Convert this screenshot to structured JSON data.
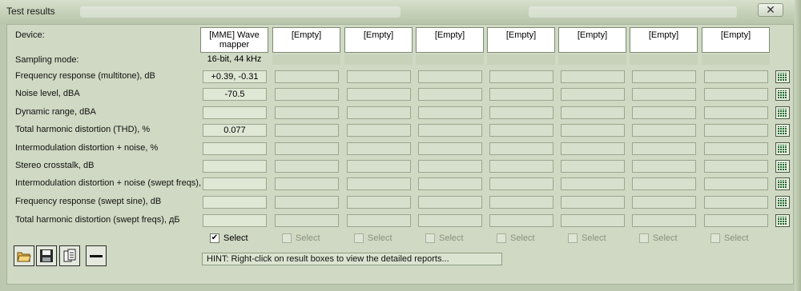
{
  "window": {
    "title": "Test results",
    "close_glyph": "✕"
  },
  "labels": {
    "device": "Device:",
    "sampling_mode": "Sampling mode:"
  },
  "devices": [
    "[MME] Wave mapper",
    "[Empty]",
    "[Empty]",
    "[Empty]",
    "[Empty]",
    "[Empty]",
    "[Empty]",
    "[Empty]"
  ],
  "sampling_modes": [
    "16-bit, 44 kHz",
    "",
    "",
    "",
    "",
    "",
    "",
    ""
  ],
  "rows": [
    {
      "label": "Frequency response (multitone), dB",
      "values": [
        "+0.39, -0.31",
        "",
        "",
        "",
        "",
        "",
        "",
        ""
      ]
    },
    {
      "label": "Noise level, dBA",
      "values": [
        "-70.5",
        "",
        "",
        "",
        "",
        "",
        "",
        ""
      ]
    },
    {
      "label": "Dynamic range, dBA",
      "values": [
        "",
        "",
        "",
        "",
        "",
        "",
        "",
        ""
      ]
    },
    {
      "label": "Total harmonic distortion (THD), %",
      "values": [
        "0.077",
        "",
        "",
        "",
        "",
        "",
        "",
        ""
      ]
    },
    {
      "label": "Intermodulation distortion + noise, %",
      "values": [
        "",
        "",
        "",
        "",
        "",
        "",
        "",
        ""
      ]
    },
    {
      "label": "Stereo crosstalk, dB",
      "values": [
        "",
        "",
        "",
        "",
        "",
        "",
        "",
        ""
      ]
    },
    {
      "label": "Intermodulation distortion + noise (swept freqs), %",
      "values": [
        "",
        "",
        "",
        "",
        "",
        "",
        "",
        ""
      ]
    },
    {
      "label": "Frequency response (swept sine), dB",
      "values": [
        "",
        "",
        "",
        "",
        "",
        "",
        "",
        ""
      ]
    },
    {
      "label": "Total harmonic distortion (swept freqs), дБ",
      "values": [
        "",
        "",
        "",
        "",
        "",
        "",
        "",
        ""
      ]
    }
  ],
  "selects": [
    {
      "label": "Select",
      "checked": true,
      "enabled": true
    },
    {
      "label": "Select",
      "checked": false,
      "enabled": false
    },
    {
      "label": "Select",
      "checked": false,
      "enabled": false
    },
    {
      "label": "Select",
      "checked": false,
      "enabled": false
    },
    {
      "label": "Select",
      "checked": false,
      "enabled": false
    },
    {
      "label": "Select",
      "checked": false,
      "enabled": false
    },
    {
      "label": "Select",
      "checked": false,
      "enabled": false
    },
    {
      "label": "Select",
      "checked": false,
      "enabled": false
    }
  ],
  "hint": "HINT: Right-click on result boxes to view the detailed reports...",
  "toolbar": [
    {
      "icon": "open-folder-icon"
    },
    {
      "icon": "save-disk-icon"
    },
    {
      "icon": "copy-clipboard-icon"
    },
    {
      "icon": "minus-icon"
    }
  ],
  "colors": {
    "window_bg": "#cfd9c3",
    "chart_icon": "#1d6b2a"
  }
}
